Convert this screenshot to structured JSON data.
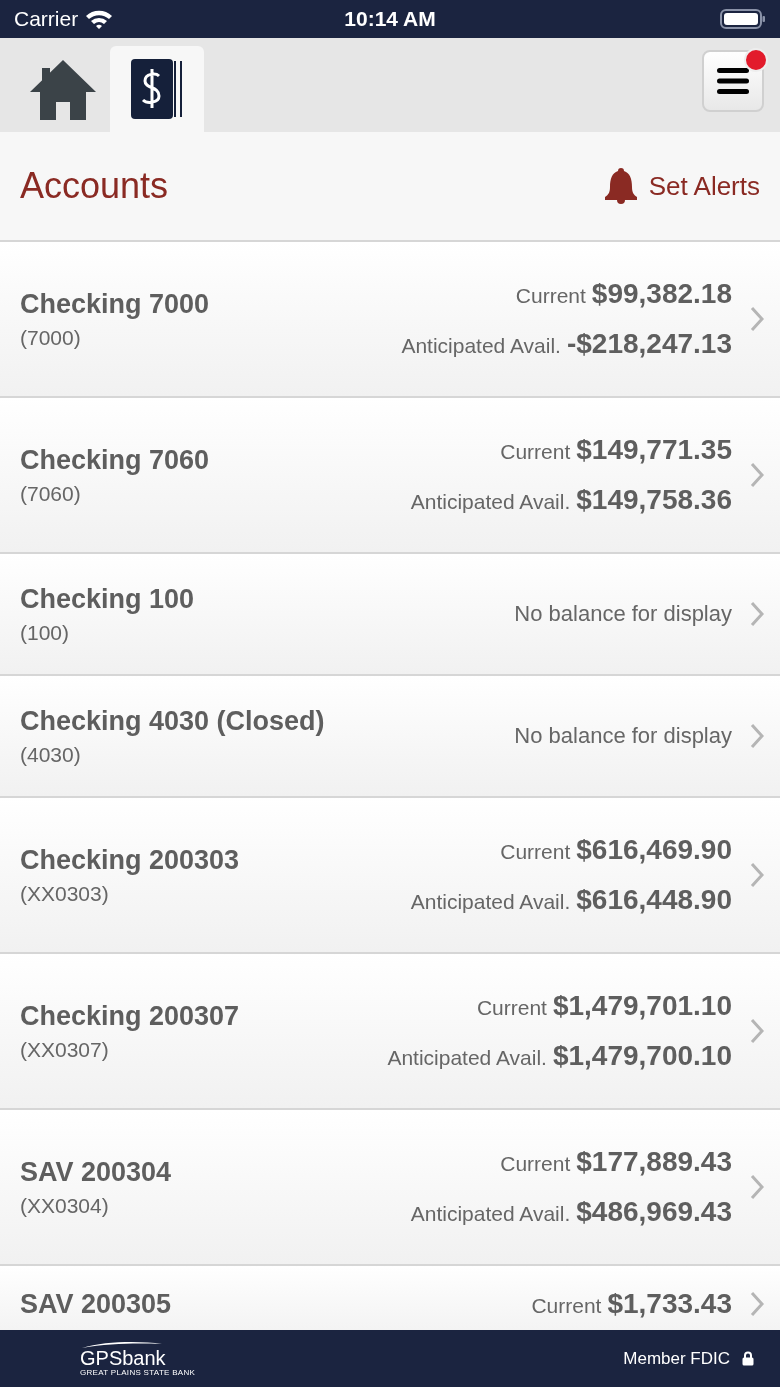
{
  "status_bar": {
    "carrier": "Carrier",
    "time": "10:14 AM"
  },
  "tabs": [
    {
      "kind": "home",
      "selected": false
    },
    {
      "kind": "accounts",
      "selected": true
    }
  ],
  "menu": {
    "notification": true
  },
  "header": {
    "title": "Accounts",
    "action": "Set Alerts"
  },
  "accounts": [
    {
      "name": "Checking 7000",
      "number": "(7000)",
      "balances": [
        {
          "label": "Current",
          "amount": "$99,382.18"
        },
        {
          "label": "Anticipated Avail.",
          "amount": "-$218,247.13"
        }
      ]
    },
    {
      "name": "Checking 7060",
      "number": "(7060)",
      "balances": [
        {
          "label": "Current",
          "amount": "$149,771.35"
        },
        {
          "label": "Anticipated Avail.",
          "amount": "$149,758.36"
        }
      ]
    },
    {
      "name": "Checking 100",
      "number": "(100)",
      "note": "No balance for display"
    },
    {
      "name": "Checking 4030 (Closed)",
      "number": "(4030)",
      "note": "No balance for display"
    },
    {
      "name": "Checking 200303",
      "number": "(XX0303)",
      "balances": [
        {
          "label": "Current",
          "amount": "$616,469.90"
        },
        {
          "label": "Anticipated Avail.",
          "amount": "$616,448.90"
        }
      ]
    },
    {
      "name": "Checking 200307",
      "number": "(XX0307)",
      "balances": [
        {
          "label": "Current",
          "amount": "$1,479,701.10"
        },
        {
          "label": "Anticipated Avail.",
          "amount": "$1,479,700.10"
        }
      ]
    },
    {
      "name": "SAV 200304",
      "number": "(XX0304)",
      "balances": [
        {
          "label": "Current",
          "amount": "$177,889.43"
        },
        {
          "label": "Anticipated Avail.",
          "amount": "$486,969.43"
        }
      ]
    },
    {
      "name": "SAV 200305",
      "balances": [
        {
          "label": "Current",
          "amount": "$1,733.43"
        }
      ]
    }
  ],
  "footer": {
    "logo": "GPSbank",
    "tagline": "GREAT PLAINS STATE BANK",
    "member": "Member FDIC"
  }
}
